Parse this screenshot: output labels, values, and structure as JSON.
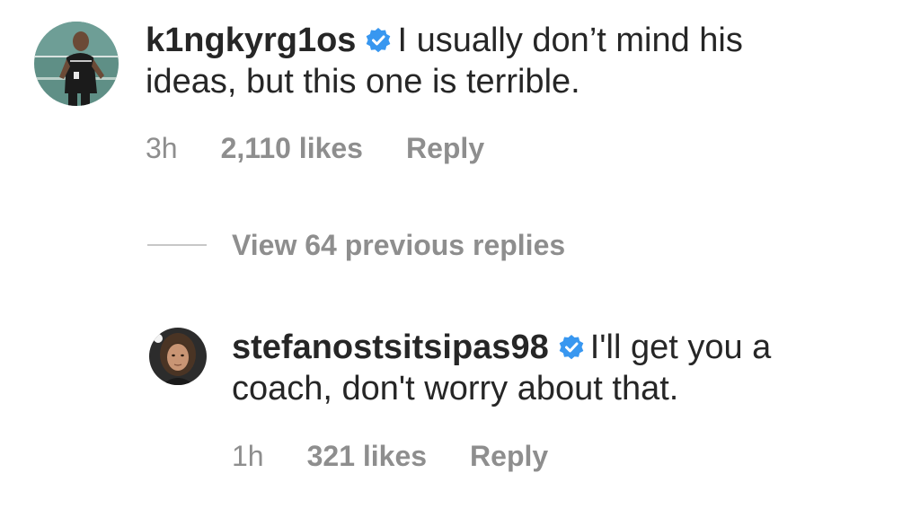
{
  "comments": [
    {
      "username": "k1ngkyrg1os",
      "verified": true,
      "line1": "I usually don’t mind his",
      "line2": "ideas, but this one is terrible.",
      "time": "3h",
      "likes": "2,110 likes",
      "reply": "Reply"
    },
    {
      "username": "stefanostsitsipas98",
      "verified": true,
      "line1": "I'll get you a",
      "line2": "coach, don't worry about that.",
      "time": "1h",
      "likes": "321 likes",
      "reply": "Reply"
    }
  ],
  "view_replies": {
    "label": "View 64 previous replies"
  },
  "colors": {
    "text": "#262626",
    "secondary": "#8e8e8e",
    "verified_blue": "#3897f0",
    "divider": "#c7c7c7"
  },
  "icons": {
    "verified": "verified-badge-icon"
  }
}
